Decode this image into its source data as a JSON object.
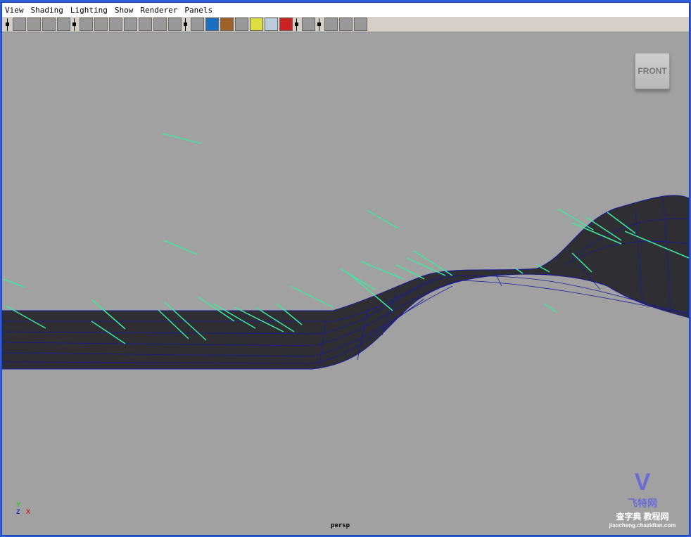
{
  "menu": [
    "View",
    "Shading",
    "Lighting",
    "Show",
    "Renderer",
    "Panels"
  ],
  "toolbar_icons": [
    "camera-icon",
    "camera-attributes-icon",
    "bookmark-icon",
    "image-plane-icon",
    "grid-icon",
    "film-gate-icon",
    "resolution-gate-icon",
    "field-chart-icon",
    "safe-action-icon",
    "safe-title-icon",
    "texture-icon",
    "wireframe-icon",
    "smooth-shade-icon",
    "flat-shade-icon",
    "shadow-icon",
    "light-icon",
    "xray-icon",
    "isolate-icon",
    "select-icon",
    "bounding-box-icon",
    "frame-icon",
    "hud-icon"
  ],
  "view_cube": {
    "label": "FRONT"
  },
  "camera_label": "persp",
  "axis": {
    "y": "Y",
    "z": "Z",
    "x": "X"
  },
  "watermark": {
    "text": "飞特网",
    "sub": "查字典 教程网",
    "url": "jiaocheng.chazidian.com"
  },
  "colors": {
    "viewport": "#a1a1a1",
    "surface": "#2e2e33",
    "wire": "#1a1aa0",
    "particles": "#40e8a0"
  }
}
